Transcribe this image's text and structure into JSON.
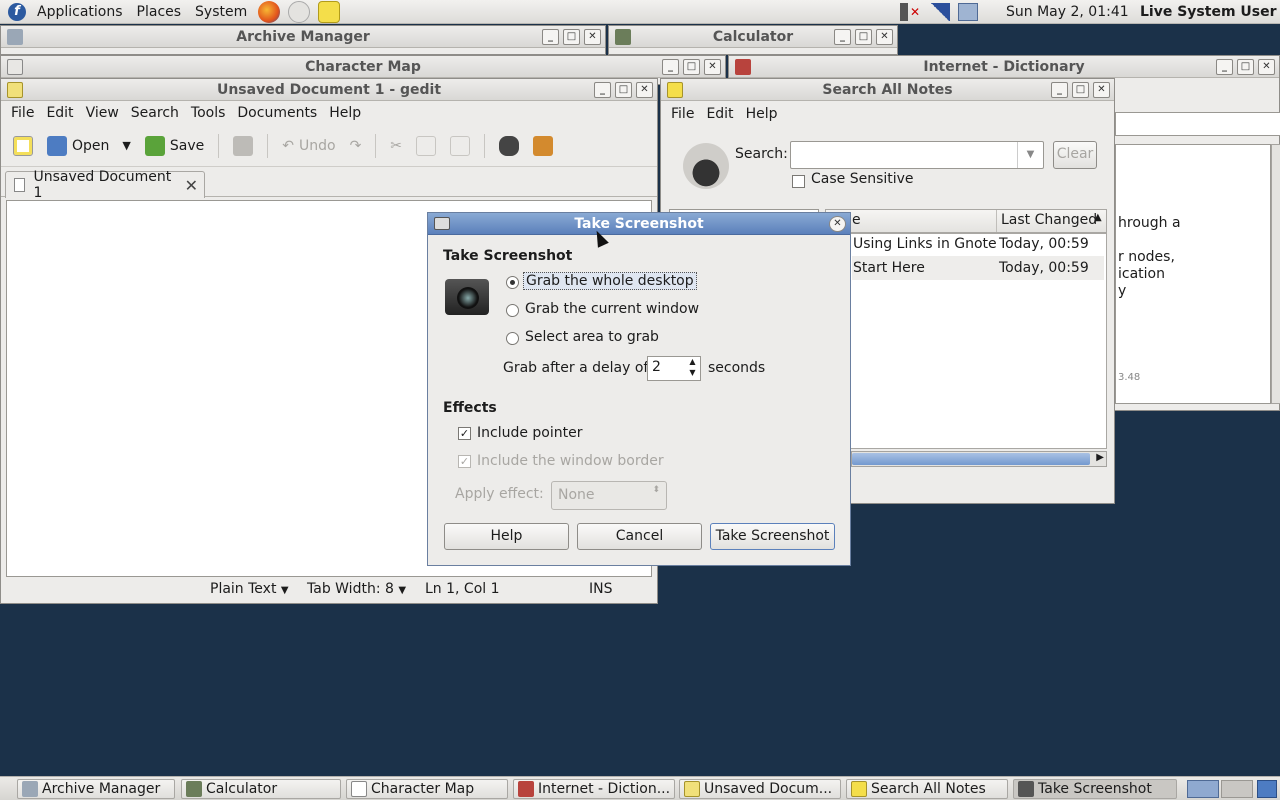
{
  "top_panel": {
    "menus": [
      "Applications",
      "Places",
      "System"
    ],
    "clock": "Sun May  2, 01:41",
    "user": "Live System User"
  },
  "windows": {
    "archive_manager": {
      "title": "Archive Manager"
    },
    "calculator": {
      "title": "Calculator"
    },
    "character_map": {
      "title": "Character Map"
    },
    "dictionary": {
      "title": "Internet - Dictionary",
      "text_fragments": [
        "hrough a",
        "r nodes,",
        "ication",
        "y",
        "3.48"
      ]
    },
    "gedit": {
      "title": "Unsaved Document 1 - gedit",
      "menus": [
        "File",
        "Edit",
        "View",
        "Search",
        "Tools",
        "Documents",
        "Help"
      ],
      "toolbar": {
        "open": "Open",
        "save": "Save",
        "undo": "Undo"
      },
      "tab_label": "Unsaved Document 1",
      "status": {
        "language": "Plain Text",
        "tab_width_label": "Tab Width:",
        "tab_width": "8",
        "position": "Ln 1, Col 1",
        "mode": "INS"
      }
    },
    "notes": {
      "title": "Search All Notes",
      "menus": [
        "File",
        "Edit",
        "Help"
      ],
      "search_label": "Search:",
      "clear_label": "Clear",
      "case_sensitive": "Case Sensitive",
      "col_note_partial": "e",
      "col_changed": "Last Changed",
      "rows": [
        {
          "note": "Using Links in Gnote",
          "changed": "Today, 00:59"
        },
        {
          "note": "Start Here",
          "changed": "Today, 00:59"
        }
      ]
    }
  },
  "dialog": {
    "title": "Take Screenshot",
    "heading": "Take Screenshot",
    "options": [
      {
        "label": "Grab the whole desktop",
        "selected": true
      },
      {
        "label": "Grab the current window",
        "selected": false
      },
      {
        "label": "Select area to grab",
        "selected": false
      }
    ],
    "delay_label": "Grab after a delay of",
    "delay_value": "2",
    "delay_unit": "seconds",
    "effects_heading": "Effects",
    "include_pointer": "Include pointer",
    "include_border": "Include the window border",
    "apply_effect_label": "Apply effect:",
    "apply_effect_value": "None",
    "buttons": {
      "help": "Help",
      "cancel": "Cancel",
      "take": "Take Screenshot"
    }
  },
  "taskbar": {
    "items": [
      "Archive Manager",
      "Calculator",
      "Character Map",
      "Internet - Diction...",
      "Unsaved Docum...",
      "Search All Notes",
      "Take Screenshot"
    ]
  },
  "colors": {
    "desktop": "#1b3149",
    "dialog_title": "#5b80bb",
    "accent": "#2c5aa0"
  }
}
